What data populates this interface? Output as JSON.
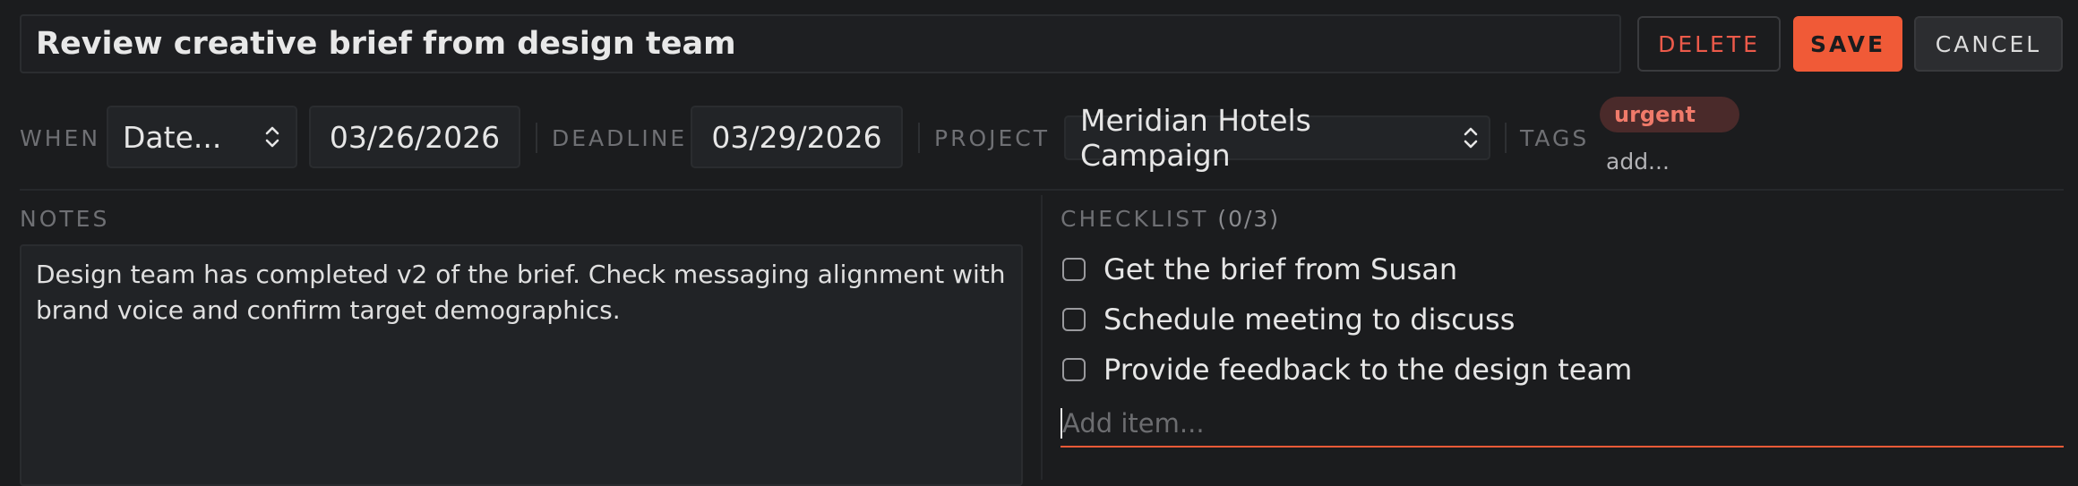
{
  "task": {
    "title": "Review creative brief from design team"
  },
  "actions": {
    "delete_label": "DELETE",
    "save_label": "SAVE",
    "cancel_label": "CANCEL"
  },
  "meta": {
    "when_label": "WHEN",
    "when_value": "Date...",
    "start_date": "03/26/2026",
    "deadline_label": "DEADLINE",
    "deadline_value": "03/29/2026",
    "project_label": "PROJECT",
    "project_value": "Meridian Hotels Campaign",
    "tags_label": "TAGS",
    "tags": [
      "urgent"
    ],
    "tag_add_placeholder": "add..."
  },
  "notes": {
    "label": "NOTES",
    "text": "Design team has completed v2 of the brief. Check messaging alignment with brand voice and confirm target demographics."
  },
  "checklist": {
    "label": "CHECKLIST",
    "count": "(0/3)",
    "items": [
      {
        "label": "Get the brief from Susan",
        "checked": false
      },
      {
        "label": "Schedule meeting to discuss",
        "checked": false
      },
      {
        "label": "Provide feedback to the design team",
        "checked": false
      }
    ],
    "add_placeholder": "Add item..."
  },
  "colors": {
    "background": "#1b1c1e",
    "accent": "#f05a37",
    "danger_text": "#ec5a4a",
    "tag_bg": "#4a2a2a",
    "tag_text": "#f07a6a"
  },
  "icons": {
    "select_chevron": "chevron-up-down-icon"
  }
}
